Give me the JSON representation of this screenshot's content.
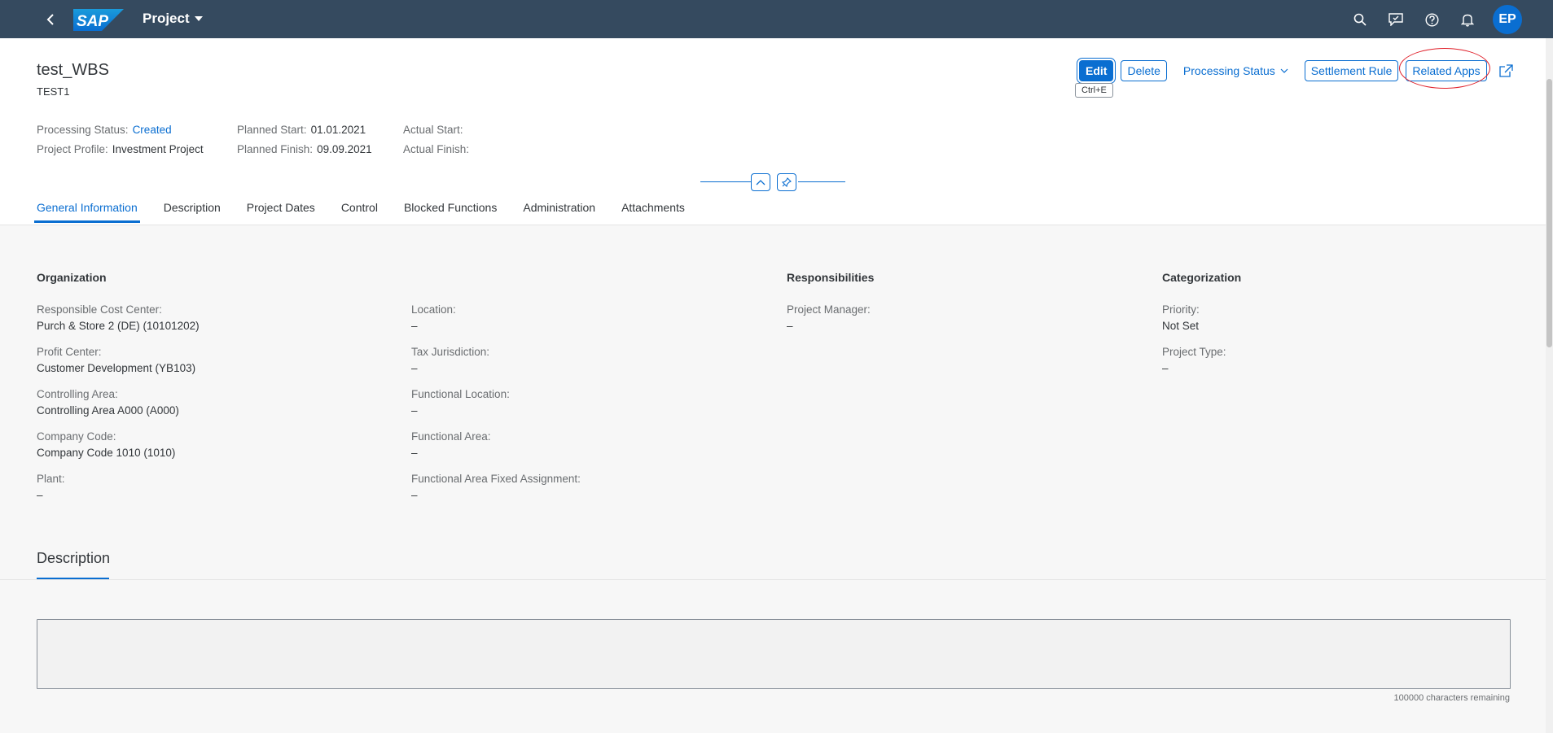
{
  "shell": {
    "app_title": "Project",
    "logo_text": "SAP",
    "avatar_initials": "EP"
  },
  "header": {
    "title": "test_WBS",
    "subtitle": "TEST1",
    "actions": {
      "edit": "Edit",
      "delete": "Delete",
      "processing_status": "Processing Status",
      "settlement_rule": "Settlement Rule",
      "related_apps": "Related Apps"
    },
    "edit_tooltip": "Ctrl+E",
    "attributes": {
      "processing_status_label": "Processing Status:",
      "processing_status_value": "Created",
      "project_profile_label": "Project Profile:",
      "project_profile_value": "Investment Project",
      "planned_start_label": "Planned Start:",
      "planned_start_value": "01.01.2021",
      "planned_finish_label": "Planned Finish:",
      "planned_finish_value": "09.09.2021",
      "actual_start_label": "Actual Start:",
      "actual_finish_label": "Actual Finish:"
    }
  },
  "tabs": [
    {
      "label": "General Information",
      "active": true
    },
    {
      "label": "Description"
    },
    {
      "label": "Project Dates"
    },
    {
      "label": "Control"
    },
    {
      "label": "Blocked Functions"
    },
    {
      "label": "Administration"
    },
    {
      "label": "Attachments"
    }
  ],
  "general": {
    "organization_title": "Organization",
    "responsibilities_title": "Responsibilities",
    "categorization_title": "Categorization",
    "fields": {
      "resp_cost_center": {
        "label": "Responsible Cost Center:",
        "value": "Purch & Store 2 (DE) (10101202)"
      },
      "profit_center": {
        "label": "Profit Center:",
        "value": "Customer Development (YB103)"
      },
      "controlling_area": {
        "label": "Controlling Area:",
        "value": "Controlling Area A000 (A000)"
      },
      "company_code": {
        "label": "Company Code:",
        "value": "Company Code 1010 (1010)"
      },
      "plant": {
        "label": "Plant:",
        "value": "–"
      },
      "location": {
        "label": "Location:",
        "value": "–"
      },
      "tax_jurisdiction": {
        "label": "Tax Jurisdiction:",
        "value": "–"
      },
      "functional_location": {
        "label": "Functional Location:",
        "value": "–"
      },
      "functional_area": {
        "label": "Functional Area:",
        "value": "–"
      },
      "functional_area_fixed": {
        "label": "Functional Area Fixed Assignment:",
        "value": "–"
      },
      "project_manager": {
        "label": "Project Manager:",
        "value": "–"
      },
      "priority": {
        "label": "Priority:",
        "value": "Not Set"
      },
      "project_type": {
        "label": "Project Type:",
        "value": "–"
      }
    }
  },
  "description": {
    "heading": "Description",
    "text": "",
    "char_counter": "100000 characters remaining"
  },
  "colors": {
    "shell_bg": "#354a5f",
    "accent": "#0a6ed1",
    "highlight": "#e0202a"
  }
}
